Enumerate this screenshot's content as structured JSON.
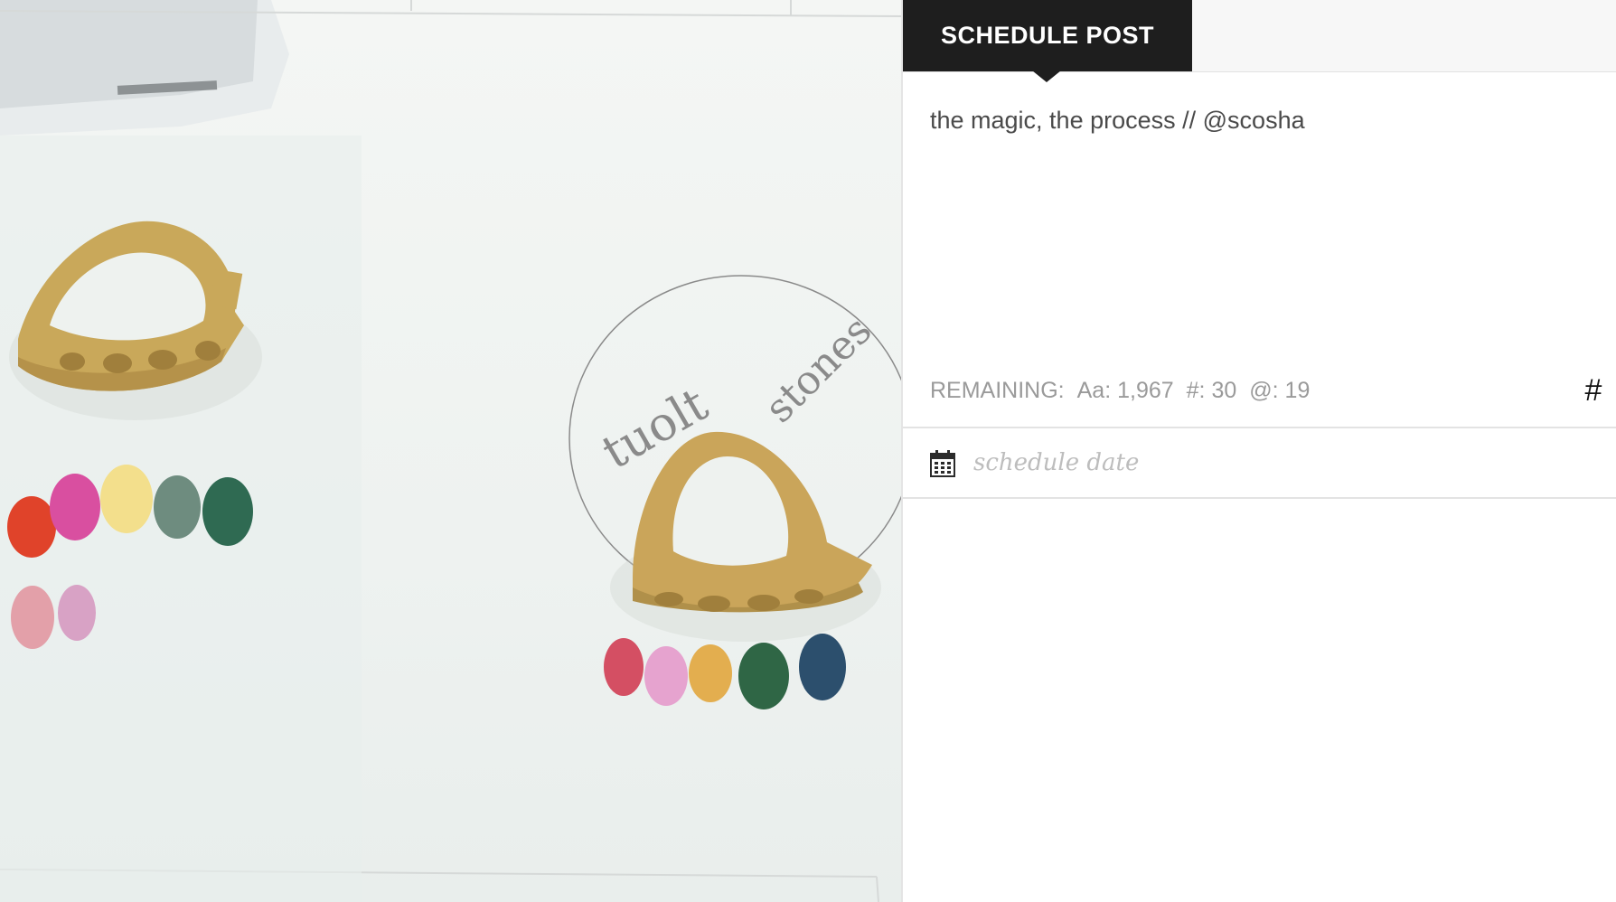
{
  "photo": {
    "description_icon": "photo-preview"
  },
  "tabs": {
    "schedule_label": "SCHEDULE POST"
  },
  "caption": {
    "text": "the magic, the process // @scosha"
  },
  "remaining": {
    "prefix": "REMAINING:",
    "chars": "Aa: 1,967",
    "hashtags": "#: 30",
    "mentions": "@: 19"
  },
  "hashtag_button": {
    "label": "#"
  },
  "schedule": {
    "placeholder": "schedule date",
    "icon": "calendar-icon"
  },
  "colors": {
    "tab_bg": "#1e1e1e",
    "muted_text": "#9a9a9a"
  }
}
